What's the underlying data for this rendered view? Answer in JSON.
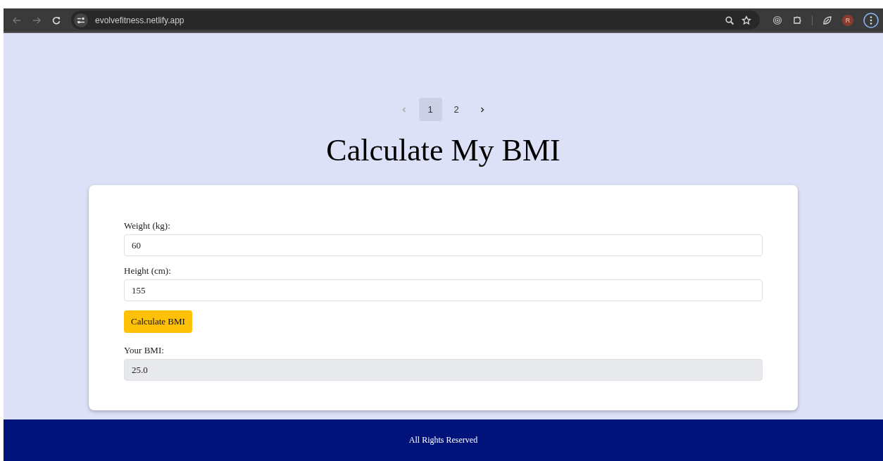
{
  "browser": {
    "url": "evolvefitness.netlify.app",
    "profile_initial": "R"
  },
  "pagination": {
    "prev_disabled": true,
    "next_disabled": false,
    "pages": [
      {
        "label": "1",
        "selected": true
      },
      {
        "label": "2",
        "selected": false
      }
    ]
  },
  "title": "Calculate My BMI",
  "form": {
    "fields": [
      {
        "kind": "input",
        "label": "Weight (kg):",
        "value": "60"
      },
      {
        "kind": "input",
        "label": "Height (cm):",
        "value": "155"
      },
      {
        "kind": "button",
        "label": "Calculate BMI"
      },
      {
        "kind": "output",
        "label": "Your BMI:",
        "value": "25.0"
      }
    ]
  },
  "footer": {
    "text": "All Rights Reserved"
  }
}
